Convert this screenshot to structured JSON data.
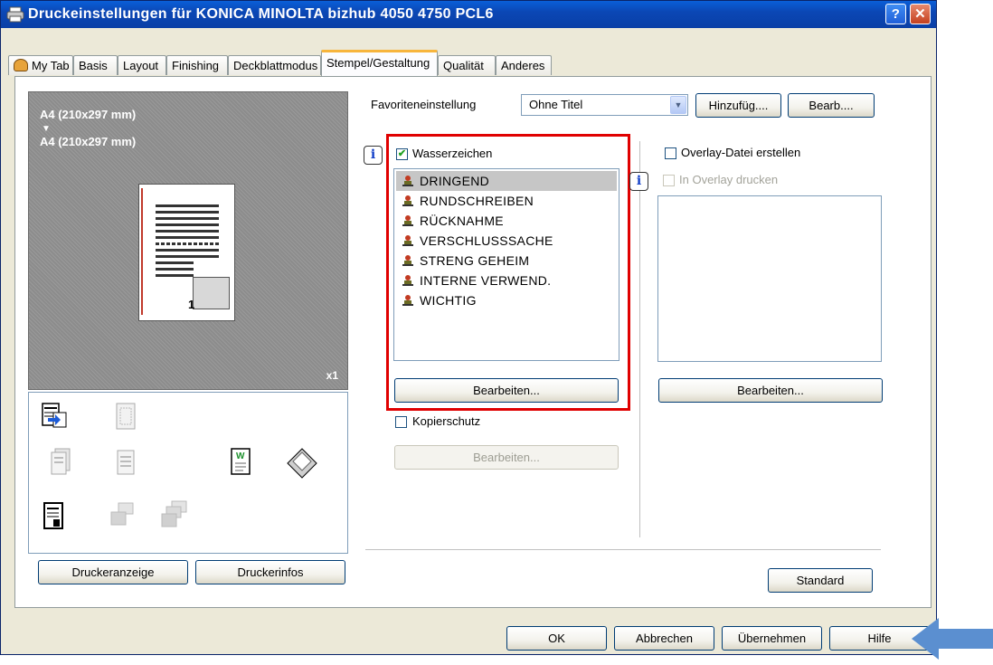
{
  "window": {
    "title": "Druckeinstellungen für KONICA MINOLTA bizhub 4050 4750 PCL6",
    "help_label": "?",
    "close_label": "✕"
  },
  "tabs": [
    {
      "label": "My Tab"
    },
    {
      "label": "Basis"
    },
    {
      "label": "Layout"
    },
    {
      "label": "Finishing"
    },
    {
      "label": "Deckblattmodus"
    },
    {
      "label": "Stempel/Gestaltung"
    },
    {
      "label": "Qualität"
    },
    {
      "label": "Anderes"
    }
  ],
  "preview": {
    "paper_in": "A4 (210x297 mm)",
    "paper_out": "A4 (210x297 mm)",
    "arrow": "▼",
    "page_number": "1",
    "copies": "x1"
  },
  "left_buttons": {
    "printer_view": "Druckeranzeige",
    "printer_info": "Druckerinfos"
  },
  "favorites": {
    "label": "Favoriteneinstellung",
    "value": "Ohne Titel",
    "add": "Hinzufüg....",
    "edit": "Bearb...."
  },
  "watermark": {
    "label": "Wasserzeichen",
    "checked": true,
    "items": [
      "DRINGEND",
      "RUNDSCHREIBEN",
      "RÜCKNAHME",
      "VERSCHLUSSSACHE",
      "STRENG GEHEIM",
      "INTERNE VERWEND.",
      "WICHTIG"
    ],
    "selected": "DRINGEND",
    "edit": "Bearbeiten..."
  },
  "copy_protect": {
    "label": "Kopierschutz",
    "edit": "Bearbeiten..."
  },
  "overlay": {
    "create_label": "Overlay-Datei erstellen",
    "print_label": "In Overlay drucken",
    "edit": "Bearbeiten..."
  },
  "standard": "Standard",
  "dialog_buttons": {
    "ok": "OK",
    "cancel": "Abbrechen",
    "apply": "Übernehmen",
    "help": "Hilfe"
  },
  "info_glyph": "i",
  "colors": {
    "title_bar": "#0b47b5",
    "highlight_box": "#e00000",
    "annotation_arrow": "#5b8fd0"
  }
}
